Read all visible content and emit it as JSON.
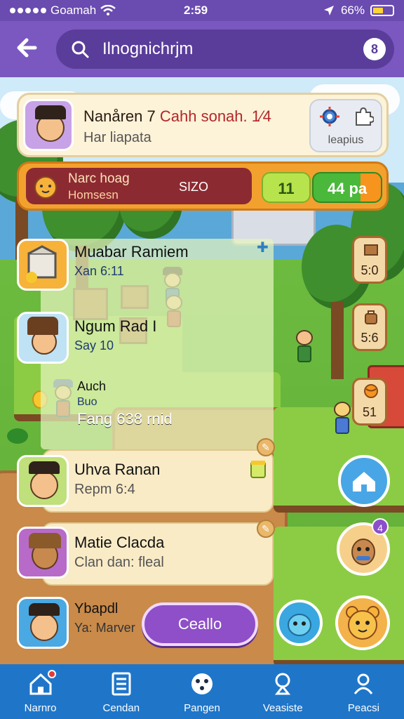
{
  "status_bar": {
    "carrier": "Goamah",
    "time": "2:59",
    "battery": "66%"
  },
  "header": {
    "search_text": "Ilnognichrjm",
    "pin_label": "8"
  },
  "profile": {
    "name": "Nanåren 7",
    "name_suffix": "Cahh sonah. 1⁄4",
    "subtitle": "Har liapata",
    "settings_label": "leapius"
  },
  "quest_bar": {
    "title": "Narc hoag",
    "subtitle": "Homsesn",
    "amount": "SIZO",
    "pill_1": "11",
    "pill_2": "44 pa"
  },
  "panel": {
    "row1": {
      "title": "Muabar Ramiem",
      "sub": "Xan 6:11"
    },
    "row2": {
      "title": "Ngum Rad I",
      "sub": "Say 10"
    },
    "row3": {
      "title": "Auch",
      "sub": "Buo",
      "extra": "Fang 638 rnid"
    }
  },
  "list_cards": [
    {
      "title": "Uhva Ranan",
      "sub": "Repm 6:4"
    },
    {
      "title": "Matie Clacda",
      "sub": "Clan dan: fleal"
    },
    {
      "title": "Ybapdl",
      "sub": "Ya: Marver"
    }
  ],
  "resources": [
    "5:0",
    "5:6",
    "51"
  ],
  "cta_label": "Ceallo",
  "pet_badge": "4",
  "nav": [
    {
      "label": "Narnro"
    },
    {
      "label": "Cendan"
    },
    {
      "label": "Pangen"
    },
    {
      "label": "Veasiste"
    },
    {
      "label": "Peacsi"
    }
  ],
  "colors": {
    "header": "#7a58c0",
    "nav": "#1f76c9",
    "quest": "#f3a12e",
    "cta": "#8e4fc8"
  }
}
